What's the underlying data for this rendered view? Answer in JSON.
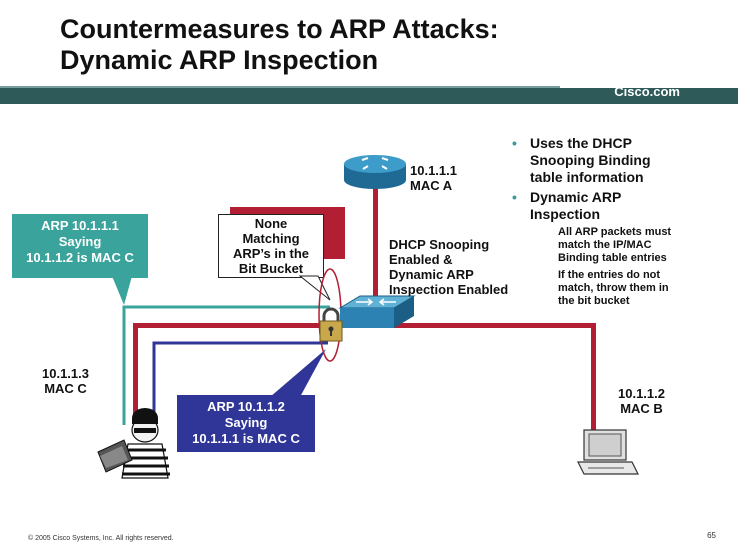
{
  "title": {
    "line1": "Countermeasures to ARP Attacks:",
    "line2": "Dynamic ARP Inspection"
  },
  "brand": "Cisco.com",
  "router": {
    "ip": "10.1.1.1",
    "mac": "MAC A"
  },
  "switch_label": {
    "line1": "DHCP Snooping",
    "line2": "Enabled  &",
    "line3": "Dynamic ARP",
    "line4": "Inspection Enabled"
  },
  "attacker": {
    "ip": "10.1.1.3",
    "mac": "MAC C"
  },
  "host_b": {
    "ip": "10.1.1.2",
    "mac": "MAC B"
  },
  "callout_teal": {
    "line1": "ARP 10.1.1.1",
    "line2": "Saying",
    "line3": "10.1.1.2 is MAC C"
  },
  "callout_blue": {
    "line1": "ARP 10.1.1.2",
    "line2": "Saying",
    "line3": "10.1.1.1 is MAC C"
  },
  "bit_bucket": {
    "line1": "None",
    "line2": "Matching",
    "line3": "ARP’s in the",
    "line4": "Bit Bucket"
  },
  "bullets": [
    {
      "text_line1": "Uses the DHCP",
      "text_line2": "Snooping Binding",
      "text_line3": "table information"
    },
    {
      "text_line1": "Dynamic ARP",
      "text_line2": "Inspection"
    }
  ],
  "sub_bullets": [
    {
      "line1": "All ARP packets must",
      "line2": "match the IP/MAC",
      "line3": "Binding table entries"
    },
    {
      "line1": "If the entries do not",
      "line2": "match, throw them in",
      "line3": "the bit bucket"
    }
  ],
  "footer": "© 2005 Cisco Systems, Inc. All rights reserved.",
  "page_number": "65",
  "colors": {
    "link_red": "#b21f35",
    "teal": "#3aa39b",
    "blue": "#2f3697",
    "band": "#2e5a5a",
    "router": "#2b82b3"
  }
}
